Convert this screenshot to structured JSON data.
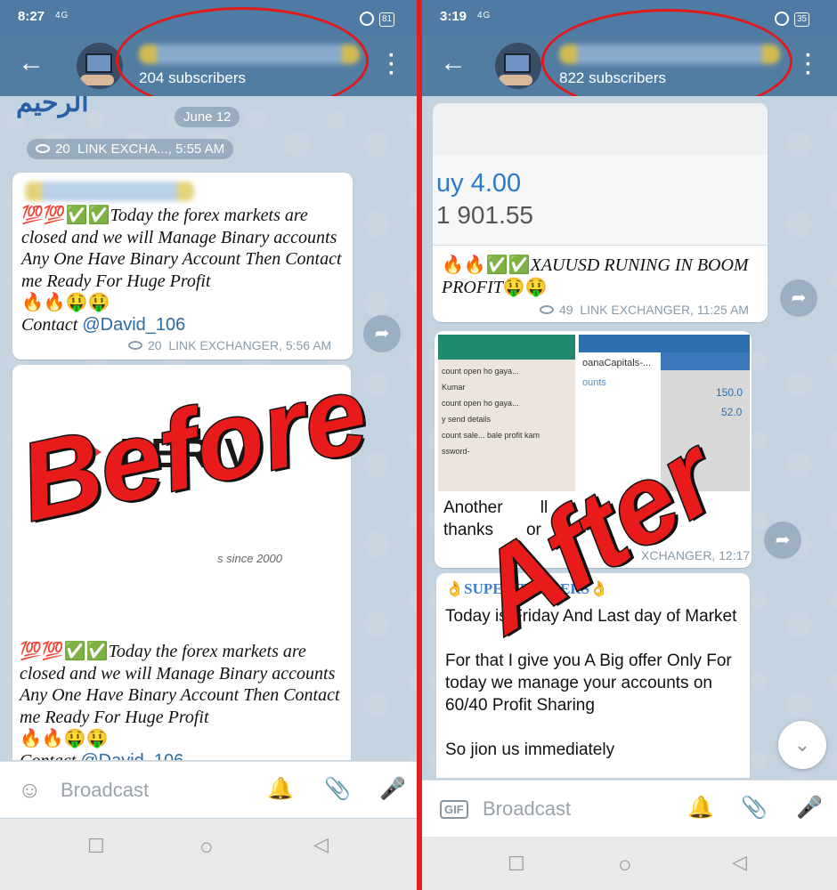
{
  "left": {
    "status": {
      "time": "8:27",
      "network": "4G",
      "battery": "81"
    },
    "channel": {
      "subscribers": "204 subscribers"
    },
    "date_pill": "June 12",
    "top_meta": {
      "views": "20",
      "sender": "LINK EXCHA..., 5:55 AM"
    },
    "msg1": {
      "prefix": "💯💯✅✅",
      "body": "Today the forex markets are closed and we will Manage Binary accounts  Any One Have Binary Account Then Contact me Ready For Huge Profit",
      "emojis": "🔥🔥🤑🤑",
      "contact_label": "Contact ",
      "contact_handle": "@David_106",
      "views": "20",
      "meta": "LINK EXCHANGER, 5:56 AM"
    },
    "msg2": {
      "logo_text": "DERIV",
      "since_text": "s since 2000",
      "prefix": "💯💯✅✅",
      "body": "Today the forex markets are closed and we will Manage Binary accounts  Any One Have Binary Account Then Contact me Ready For Huge Profit",
      "emojis": "🔥🔥🤑🤑",
      "contact_label": "Contact ",
      "contact_handle": "@David_106"
    },
    "input_placeholder": "Broadcast",
    "stamp": "Before"
  },
  "right": {
    "status": {
      "time": "3:19",
      "network": "4G",
      "battery": "35"
    },
    "channel": {
      "subscribers": "822 subscribers"
    },
    "msg1": {
      "price_top": "uy 4.00",
      "price_bottom": "1 901.55",
      "emojis": "🔥🔥✅✅",
      "body": "XAUUSD RUNING IN BOOM PROFIT",
      "emojis_end": "🤑🤑",
      "views": "49",
      "meta": "LINK EXCHANGER, 11:25 AM"
    },
    "msg2": {
      "shot_a_lines": [
        "count open ho gaya...",
        "Kumar",
        "count open ho gaya...",
        "y send details",
        "count sale... bale profit kam",
        "ssword-"
      ],
      "shot_b_lines": [
        "oanaCapitals-...",
        "ounts",
        "150.0",
        "52.0"
      ],
      "caption_line1": "Another",
      "caption_line1_end": "ll",
      "caption_line2": "thanks",
      "caption_line2_end": "or",
      "meta": "XCHANGER, 12:17 PM"
    },
    "msg3": {
      "header": "👌SUPER TRADERS👌",
      "line1": "Today is Friday And  Last day of Market",
      "line2": "For that I give you A Big offer Only For today we manage your accounts on 60/40 Profit Sharing",
      "line3": "So jion us immediately"
    },
    "input_placeholder": "Broadcast",
    "gif_label": "GIF",
    "stamp": "After"
  },
  "colors": {
    "header": "#527da3",
    "annotation_red": "#e01818",
    "chat_bg": "#c4d3e0"
  }
}
